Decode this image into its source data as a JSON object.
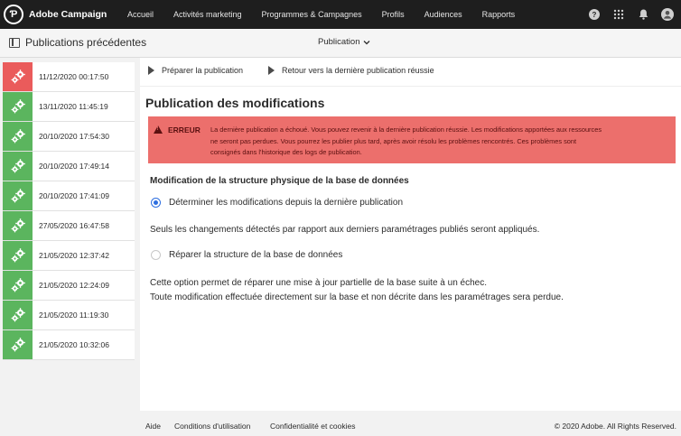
{
  "app": {
    "title": "Adobe Campaign",
    "logo_glyph": "Ƥ"
  },
  "nav": {
    "items": [
      "Accueil",
      "Activités marketing",
      "Programmes & Campagnes",
      "Profils",
      "Audiences",
      "Rapports"
    ]
  },
  "topbar_icons": [
    "help-icon",
    "apps-grid-icon",
    "bell-icon",
    "user-avatar-icon"
  ],
  "subheader": {
    "title": "Publications précédentes",
    "dropdown_label": "Publication"
  },
  "publications": [
    {
      "date": "11/12/2020 00:17:50",
      "status": "error"
    },
    {
      "date": "13/11/2020 11:45:19",
      "status": "success"
    },
    {
      "date": "20/10/2020 17:54:30",
      "status": "success"
    },
    {
      "date": "20/10/2020 17:49:14",
      "status": "success"
    },
    {
      "date": "20/10/2020 17:41:09",
      "status": "success"
    },
    {
      "date": "27/05/2020 16:47:58",
      "status": "success"
    },
    {
      "date": "21/05/2020 12:37:42",
      "status": "success"
    },
    {
      "date": "21/05/2020 12:24:09",
      "status": "success"
    },
    {
      "date": "21/05/2020 11:19:30",
      "status": "success"
    },
    {
      "date": "21/05/2020 10:32:06",
      "status": "success"
    }
  ],
  "toolbar": {
    "prepare_label": "Préparer la publication",
    "rollback_label": "Retour vers la dernière publication réussie"
  },
  "main": {
    "title": "Publication des modifications",
    "error": {
      "label": "ERREUR",
      "line1": "La dernière publication a échoué. Vous pouvez revenir à la dernière publication réussie. Les modifications apportées aux ressources",
      "line2": "ne seront pas perdues. Vous pourrez les publier plus tard, après avoir résolu les problèmes rencontrés. Ces problèmes sont",
      "line3": "consignés dans l'historique des logs de publication."
    },
    "structure_title": "Modification de la structure physique de la base de données",
    "option1": {
      "label": "Déterminer les modifications depuis la dernière publication",
      "checked": true
    },
    "option1_help": "Seuls les changements détectés par rapport aux derniers paramétrages publiés seront appliqués.",
    "option2": {
      "label": "Réparer la structure de la base de données",
      "checked": false
    },
    "option2_help_1": "Cette option permet de réparer une mise à jour partielle de la base suite à un échec.",
    "option2_help_2": "Toute modification effectuée directement sur la base et non décrite dans les paramétrages sera perdue."
  },
  "footer": {
    "help": "Aide",
    "terms": "Conditions d'utilisation",
    "privacy": "Confidentialité et cookies",
    "copyright": "© 2020 Adobe. All Rights Reserved."
  },
  "colors": {
    "topbar": "#1e1e1e",
    "success": "#5bb55e",
    "error": "#ea5b5b",
    "error_banner": "#ec6f6c",
    "radio_accent": "#2e6fe0"
  }
}
